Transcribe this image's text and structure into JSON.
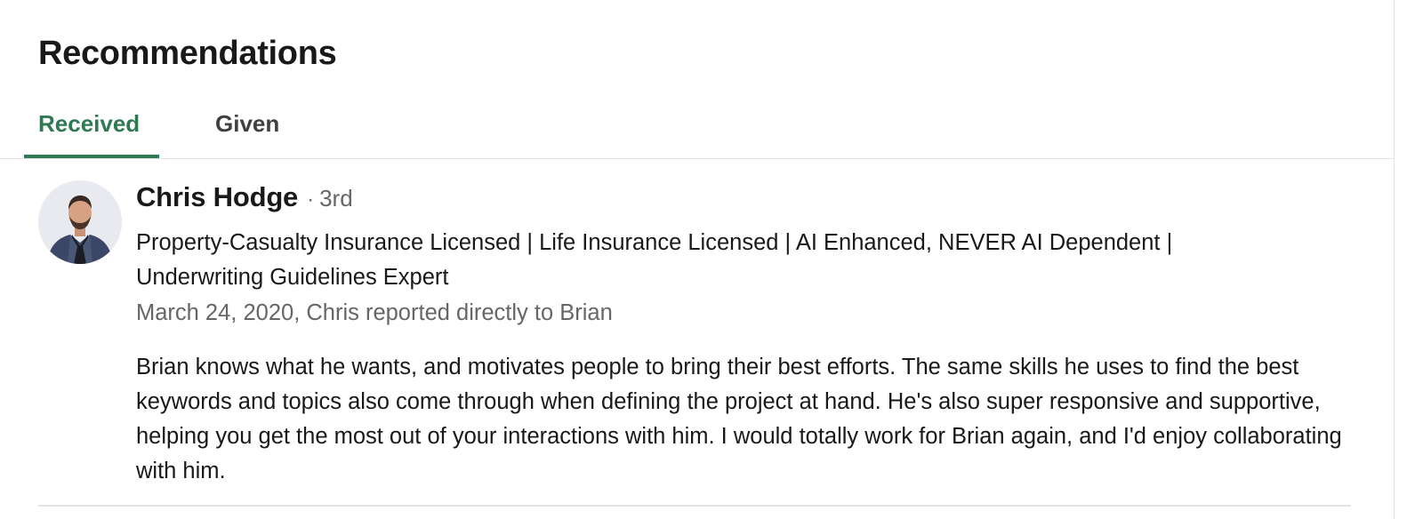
{
  "section": {
    "title": "Recommendations"
  },
  "tabs": [
    {
      "label": "Received",
      "active": true
    },
    {
      "label": "Given",
      "active": false
    }
  ],
  "recommendation": {
    "name": "Chris Hodge",
    "separator": "·",
    "degree": "3rd",
    "headline": "Property-Casualty Insurance Licensed | Life Insurance Licensed | AI Enhanced, NEVER AI Dependent | Underwriting Guidelines Expert",
    "meta": "March 24, 2020, Chris reported directly to Brian",
    "text": "Brian knows what he wants, and motivates people to bring their best efforts. The same skills he uses to find the best keywords and topics also come through when defining the project at hand. He's also super responsive and supportive, helping you get the most out of your interactions with him. I would totally work for Brian again, and I'd enjoy collaborating with him."
  },
  "colors": {
    "accent": "#2f7a52",
    "text_primary": "#191919",
    "text_secondary": "#666666",
    "divider": "#e3e3e3"
  }
}
